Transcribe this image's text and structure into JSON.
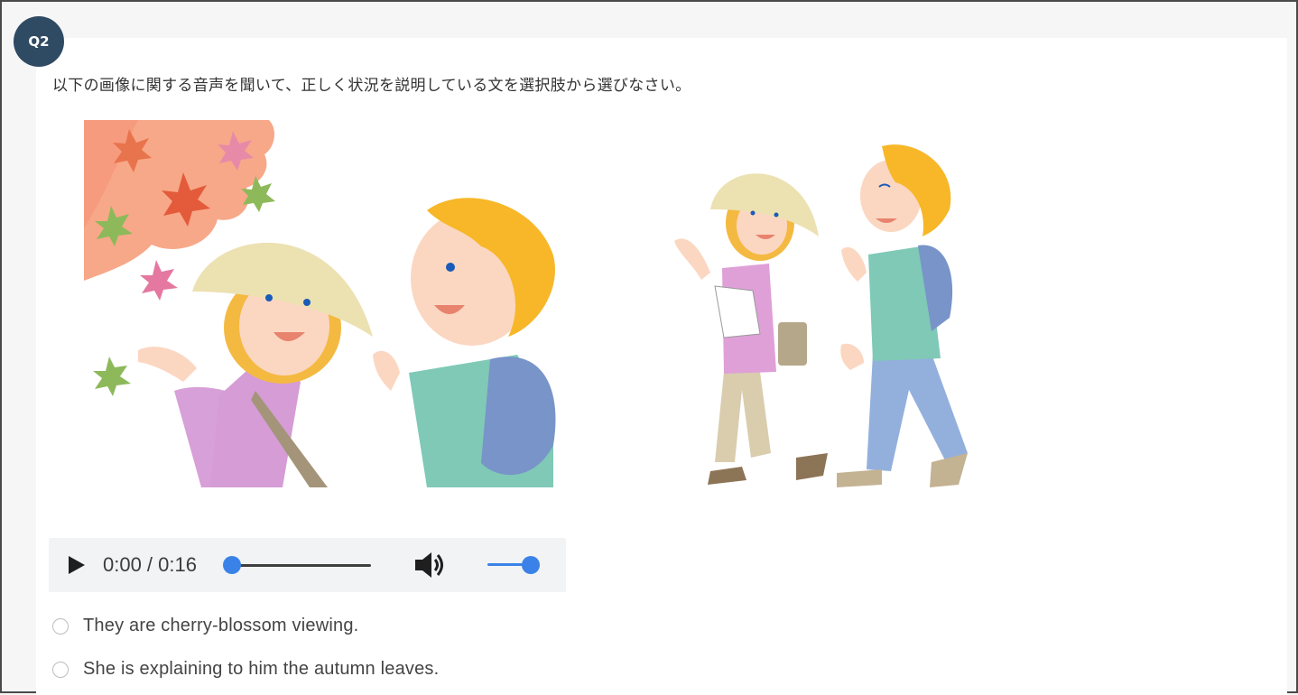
{
  "question": {
    "number": "Q2",
    "prompt": "以下の画像に関する音声を聞いて、正しく状況を説明している文を選択肢から選びなさい。"
  },
  "illustrations": [
    {
      "name": "couple-viewing-autumn-leaves"
    },
    {
      "name": "couple-walking"
    }
  ],
  "audio_player": {
    "time_display": "0:00 / 0:16",
    "progress": 0.0,
    "volume": 1.0,
    "accent_color": "#3b82e8"
  },
  "options": [
    {
      "label": "They are cherry-blossom viewing."
    },
    {
      "label": "She is explaining to him the autumn leaves."
    }
  ],
  "colors": {
    "badge": "#2f4a63",
    "background": "#f6f6f6",
    "card": "#ffffff"
  }
}
